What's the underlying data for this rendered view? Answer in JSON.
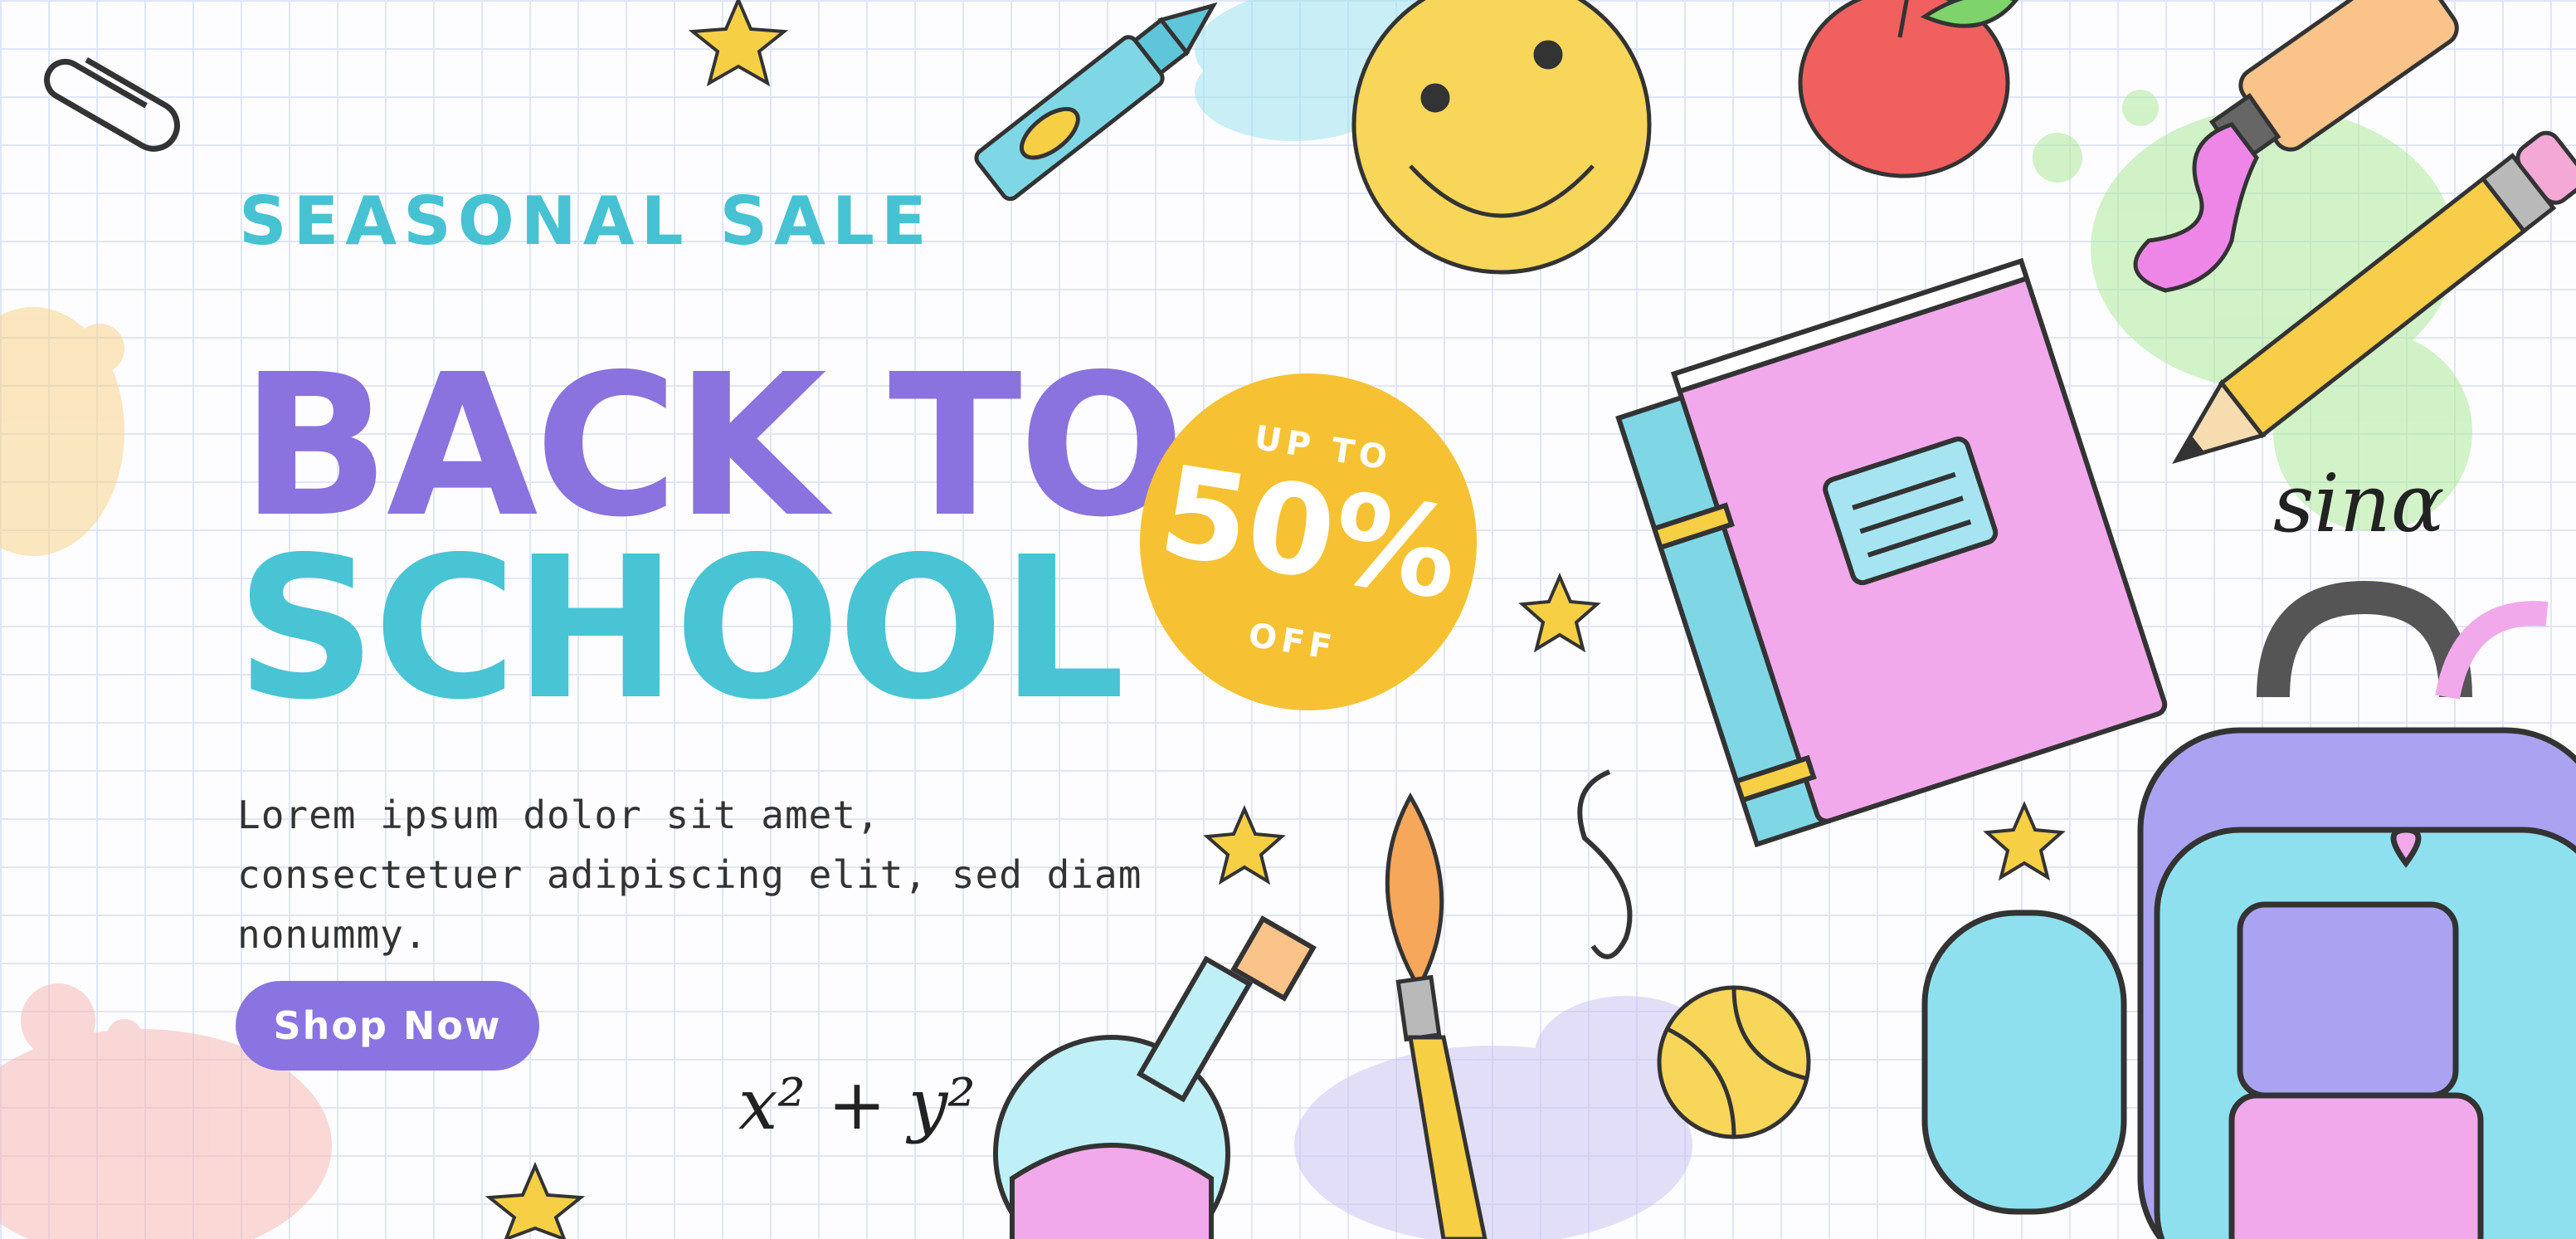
{
  "banner": {
    "eyebrow": "SEASONAL SALE",
    "title_line1": "BACK TO",
    "title_line2": "SCHOOL",
    "description": "Lorem ipsum dolor sit amet, consectetuer adipiscing elit, sed diam nonummy.",
    "cta_label": "Shop Now"
  },
  "badge": {
    "top": "UP TO",
    "value": "50%",
    "bottom": "OFF"
  },
  "doodles": {
    "sin_text": "sinα",
    "formula": "x² + y²"
  },
  "colors": {
    "purple": "#8a72df",
    "cyan": "#48c4d4",
    "yellow": "#f6c233",
    "grid": "#dfe6f7"
  },
  "icons": [
    "paperclip-icon",
    "star-icon",
    "crayon-icon",
    "smiley-icon",
    "apple-icon",
    "paint-tube-icon",
    "pencil-icon",
    "book-icon",
    "paintbrush-icon",
    "flask-icon",
    "tennis-ball-icon",
    "backpack-icon"
  ]
}
